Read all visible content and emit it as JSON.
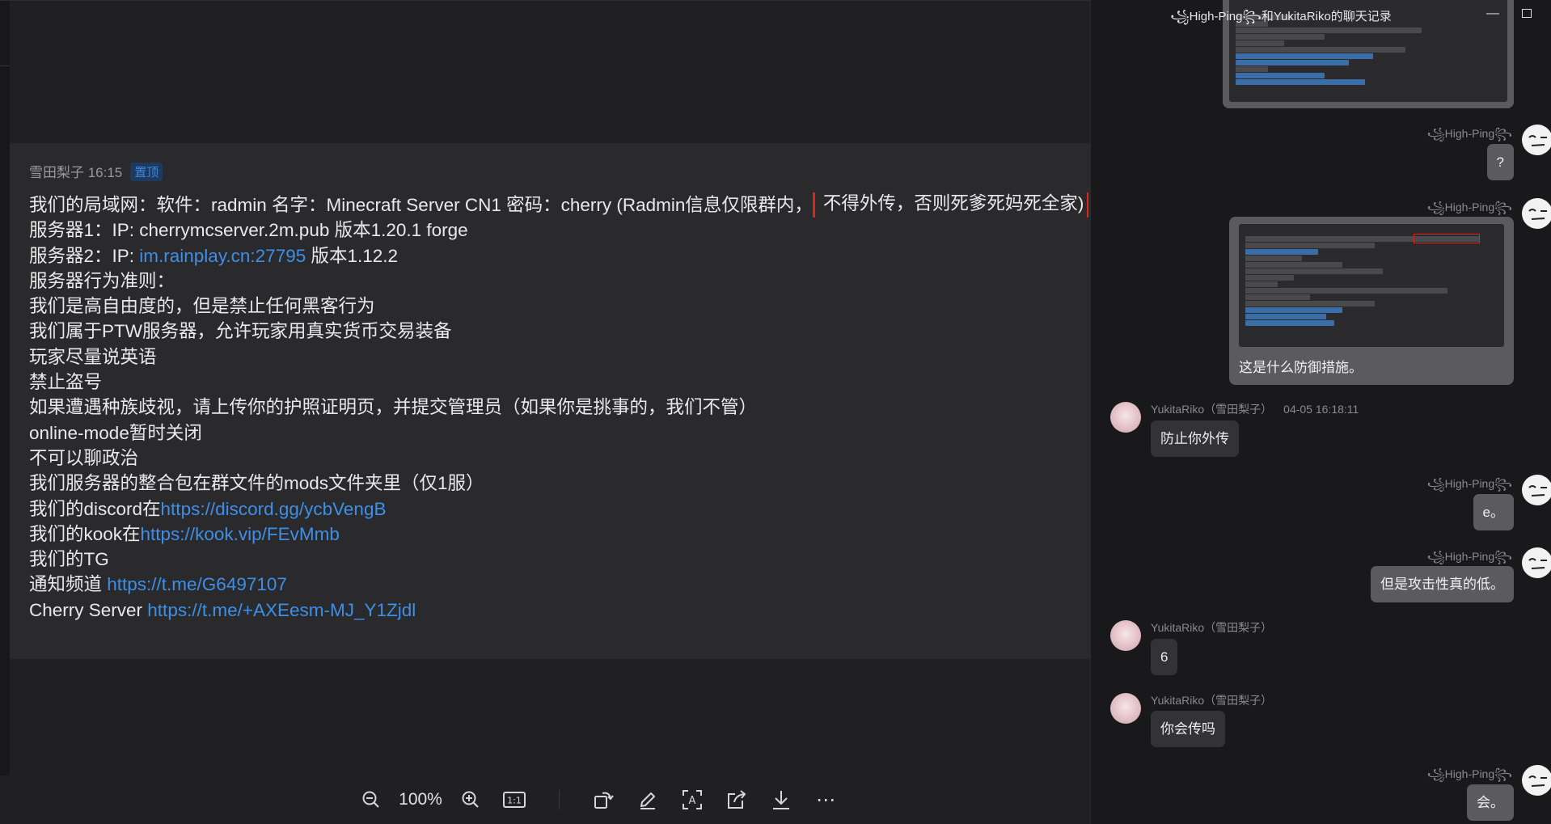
{
  "viewer": {
    "screenshot": {
      "sender": "雪田梨子 16:15",
      "pin_badge": "置顶",
      "line1_prefix": "我们的局域网：软件：radmin 名字：Minecraft Server CN1 密码：cherry (Radmin信息仅限群内，",
      "line1_highlight": "不得外传，否则死爹死妈死全家)",
      "line2": "服务器1：IP: cherrymcserver.2m.pub 版本1.20.1 forge",
      "line3_prefix": "服务器2：IP: ",
      "line3_link": "im.rainplay.cn:27795",
      "line3_suffix": " 版本1.12.2",
      "line4": "服务器行为准则：",
      "line5": "我们是高自由度的，但是禁止任何黑客行为",
      "line6": "我们属于PTW服务器，允许玩家用真实货币交易装备",
      "line7": "玩家尽量说英语",
      "line8": "禁止盗号",
      "line9": "如果遭遇种族歧视，请上传你的护照证明页，并提交管理员（如果你是挑事的，我们不管）",
      "line10": "online-mode暂时关闭",
      "line11": "不可以聊政治",
      "line12": "我们服务器的整合包在群文件的mods文件夹里（仅1服）",
      "line13_prefix": "我们的discord在",
      "line13_link": "https://discord.gg/ycbVengB",
      "line14_prefix": "我们的kook在",
      "line14_link": "https://kook.vip/FEvMmb",
      "line15": "我们的TG",
      "line16_prefix": "通知频道 ",
      "line16_link": "https://t.me/G6497107",
      "line17_prefix": "Cherry Server ",
      "line17_link": "https://t.me/+AXEesm-MJ_Y1Zjdl"
    },
    "toolbar": {
      "zoom_out_icon": "−",
      "zoom_level": "100%",
      "zoom_in_icon": "+",
      "actual_size_icon": "1:1",
      "rotate_icon": "⤴",
      "edit_icon": "✎",
      "ocr_icon": "A",
      "share_icon": "⇪",
      "download_icon": "⤓",
      "more_icon": "⋯"
    }
  },
  "chat": {
    "title": "꧁High-Ping꧂和YukitaRiko的聊天记录",
    "minimize": "—",
    "messages": [
      {
        "sender": "꧁High-Ping꧂",
        "text": "?"
      },
      {
        "sender": "꧁High-Ping꧂",
        "caption": "这是什么防御措施。"
      },
      {
        "sender": "YukitaRiko（雪田梨子）",
        "time": "04-05 16:18:11",
        "text": "防止你外传"
      },
      {
        "sender": "꧁High-Ping꧂",
        "text": "e。"
      },
      {
        "sender": "꧁High-Ping꧂",
        "text": "但是攻击性真的低。"
      },
      {
        "sender": "YukitaRiko（雪田梨子）",
        "text": "6"
      },
      {
        "sender": "YukitaRiko（雪田梨子）",
        "text": "你会传吗"
      },
      {
        "sender": "꧁High-Ping꧂",
        "text": "会。"
      }
    ]
  },
  "colors": {
    "link": "#3d8fe8",
    "highlight_box": "#e0241a",
    "my_bubble": "#5b5b5d",
    "their_bubble": "#333335"
  }
}
